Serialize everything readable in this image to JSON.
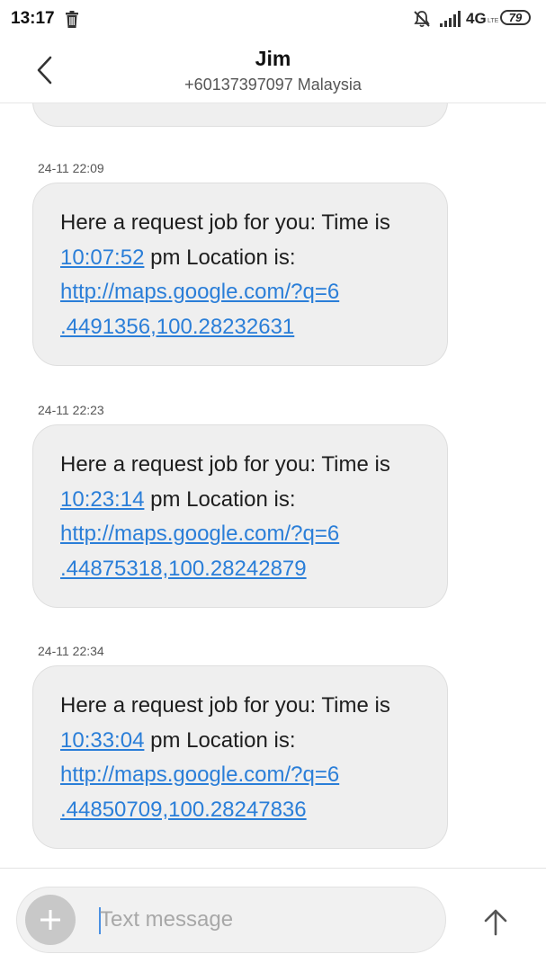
{
  "status_bar": {
    "time": "13:17",
    "network": "4G",
    "network_sub": "LTE",
    "battery": "79",
    "icons": [
      "trash-icon",
      "mute-icon",
      "signal-icon"
    ]
  },
  "header": {
    "contact_name": "Jim",
    "contact_number": "+60137397097 Malaysia",
    "back_icon": "chevron-left-icon"
  },
  "messages": [
    {
      "timestamp": "24-11 22:09",
      "intro": "Here a request job for you: Time is ",
      "time_link": "10:07:52",
      "middle": " pm Location is: ",
      "url_line1": "http://maps.google.com/?q=6",
      "url_line2": ".4491356,100.28232631"
    },
    {
      "timestamp": "24-11 22:23",
      "intro": "Here a request job for you: Time is ",
      "time_link": "10:23:14",
      "middle": " pm Location is: ",
      "url_line1": "http://maps.google.com/?q=6",
      "url_line2": ".44875318,100.28242879"
    },
    {
      "timestamp": "24-11 22:34",
      "intro": "Here a request job for you: Time is ",
      "time_link": "10:33:04",
      "middle": " pm Location is: ",
      "url_line1": "http://maps.google.com/?q=6",
      "url_line2": ".44850709,100.28247836"
    }
  ],
  "compose": {
    "placeholder": "Text message",
    "value": "",
    "add_icon": "plus-icon",
    "send_icon": "arrow-up-icon"
  },
  "colors": {
    "link": "#2a7ed8",
    "bubble": "#efefef",
    "caret": "#4a90e2"
  }
}
